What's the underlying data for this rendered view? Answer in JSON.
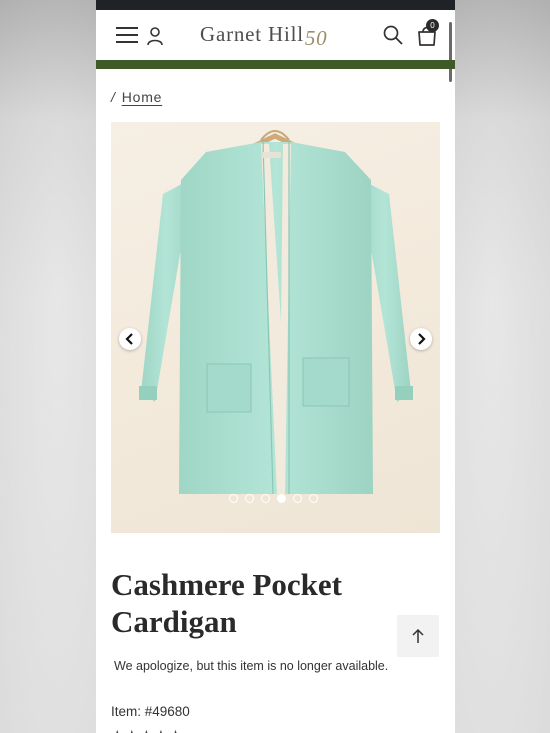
{
  "header": {
    "brand_name": "Garnet Hill",
    "brand_anniversary": "50",
    "cart_count": "0",
    "icons": [
      "menu-icon",
      "account-icon",
      "search-icon",
      "bag-icon"
    ]
  },
  "breadcrumb": {
    "separator": "/",
    "home_label": "Home"
  },
  "gallery": {
    "slide_count": 6,
    "active_slide": 4,
    "icons": [
      "chevron-left-icon",
      "chevron-right-icon"
    ]
  },
  "product": {
    "title_line1": "Cashmere Pocket",
    "title_line2": "Cardigan",
    "availability_message": "We apologize, but this item is no longer available.",
    "item_number": "Item: #49680",
    "rating_stars": "★★★★★"
  },
  "colors": {
    "accent_band": "#3f5a29",
    "cardigan": "#a9dfd0",
    "backdrop": "#f4ecdf"
  }
}
